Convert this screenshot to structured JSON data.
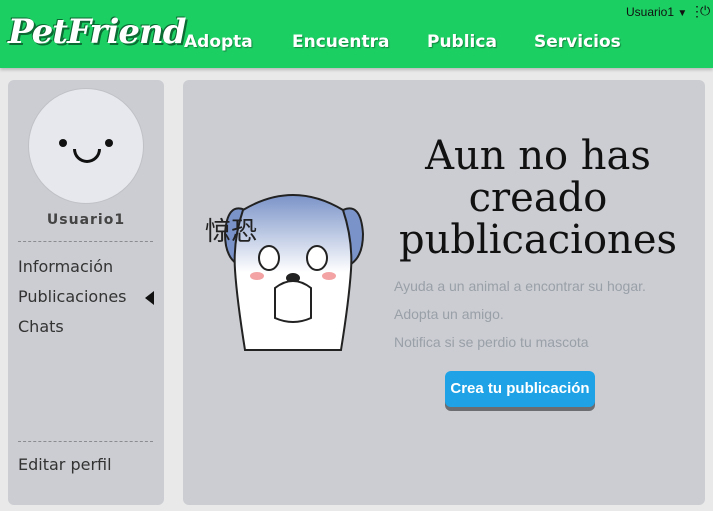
{
  "header": {
    "logo_text": "PetFriend",
    "nav": [
      {
        "label": "Adopta"
      },
      {
        "label": "Encuentra"
      },
      {
        "label": "Publica"
      },
      {
        "label": "Servicios"
      }
    ],
    "user_menu_label": "Usuario1",
    "icons": [
      "caret-down-icon",
      "kebab-menu-icon",
      "power-icon"
    ]
  },
  "sidebar": {
    "username": "Usuario1",
    "links": [
      {
        "label": "Información"
      },
      {
        "label": "Publicaciones",
        "active": true
      },
      {
        "label": "Chats"
      }
    ],
    "edit_profile": "Editar perfil"
  },
  "main": {
    "headline_lines": [
      "Aun no has",
      "creado",
      "publicaciones"
    ],
    "illustration_text": "惊恐",
    "tips": [
      "Ayuda a un animal a encontrar su hogar.",
      "Adopta un amigo.",
      "Notifica si se perdio tu mascota"
    ],
    "create_button": "Crea tu publicación"
  },
  "colors": {
    "header_green": "#1ccf63",
    "panel_gray": "#cbcdd2",
    "button_blue": "#1fa3e6"
  }
}
